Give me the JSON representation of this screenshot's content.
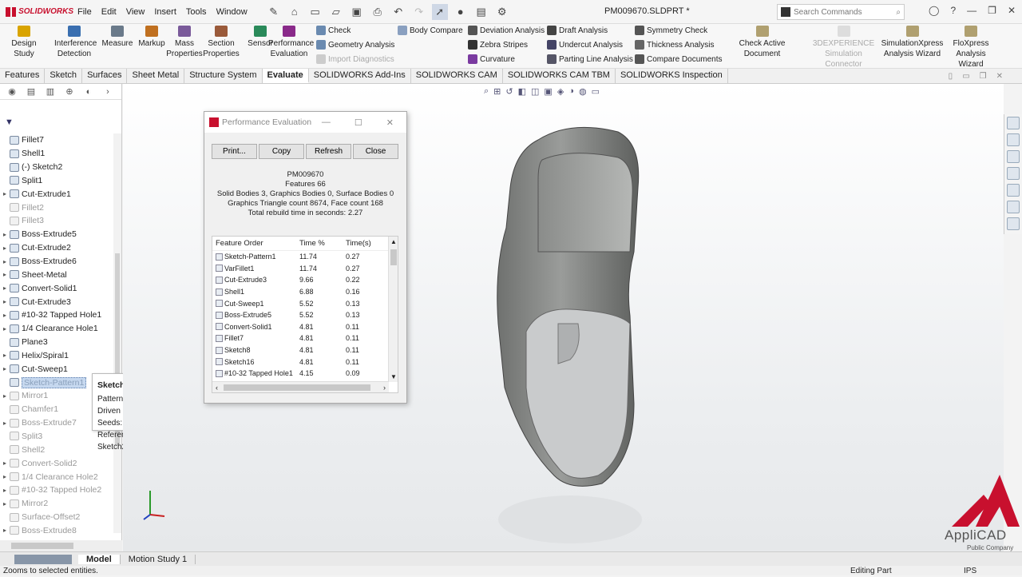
{
  "app": {
    "logo_text": "SOLIDWORKS",
    "menu": [
      "File",
      "Edit",
      "View",
      "Insert",
      "Tools",
      "Window"
    ],
    "doc_title": "PM009670.SLDPRT *",
    "search_placeholder": "Search Commands"
  },
  "ribbon": {
    "large": [
      {
        "label": "Design Study",
        "color": "#d9a400"
      },
      {
        "label": "Interference Detection",
        "color": "#3a6fb0"
      },
      {
        "label": "Measure",
        "color": "#6a7a8a"
      },
      {
        "label": "Markup",
        "color": "#c07020"
      },
      {
        "label": "Mass Properties",
        "color": "#7a5a9a"
      },
      {
        "label": "Section Properties",
        "color": "#9a5a3a"
      },
      {
        "label": "Sensor",
        "color": "#2a8a5a"
      },
      {
        "label": "Performance Evaluation",
        "color": "#8a2a8a"
      }
    ],
    "small_col1": [
      {
        "label": "Check",
        "grey": false
      },
      {
        "label": "Geometry Analysis",
        "grey": false
      },
      {
        "label": "Import Diagnostics",
        "grey": true
      }
    ],
    "body_compare": "Body Compare",
    "col2": [
      "Deviation Analysis",
      "Zebra Stripes",
      "Curvature"
    ],
    "col3": [
      "Draft Analysis",
      "Undercut Analysis",
      "Parting Line Analysis"
    ],
    "col4": [
      "Symmetry Check",
      "Thickness Analysis",
      "Compare Documents"
    ],
    "check_active": "Check Active Document",
    "experience": "3DEXPERIENCE Simulation Connector",
    "simxpress": "SimulationXpress Analysis Wizard",
    "floxpress": "FloXpress Analysis Wizard"
  },
  "tabs": [
    "Features",
    "Sketch",
    "Surfaces",
    "Sheet Metal",
    "Structure System",
    "Evaluate",
    "SOLIDWORKS Add-Ins",
    "SOLIDWORKS CAM",
    "SOLIDWORKS CAM TBM",
    "SOLIDWORKS Inspection"
  ],
  "active_tab": "Evaluate",
  "tree": [
    {
      "label": "Fillet7",
      "state": "normal",
      "arrow": false
    },
    {
      "label": "Shell1",
      "state": "normal",
      "arrow": false
    },
    {
      "label": "(-) Sketch2",
      "state": "normal",
      "arrow": false
    },
    {
      "label": "Split1",
      "state": "normal",
      "arrow": false
    },
    {
      "label": "Cut-Extrude1",
      "state": "normal",
      "arrow": true
    },
    {
      "label": "Fillet2",
      "state": "sup",
      "arrow": false
    },
    {
      "label": "Fillet3",
      "state": "sup",
      "arrow": false
    },
    {
      "label": "Boss-Extrude5",
      "state": "normal",
      "arrow": true
    },
    {
      "label": "Cut-Extrude2",
      "state": "normal",
      "arrow": true
    },
    {
      "label": "Boss-Extrude6",
      "state": "normal",
      "arrow": true
    },
    {
      "label": "Sheet-Metal",
      "state": "normal",
      "arrow": true
    },
    {
      "label": "Convert-Solid1",
      "state": "normal",
      "arrow": true
    },
    {
      "label": "Cut-Extrude3",
      "state": "normal",
      "arrow": true
    },
    {
      "label": "#10-32 Tapped Hole1",
      "state": "normal",
      "arrow": true
    },
    {
      "label": "1/4 Clearance Hole1",
      "state": "normal",
      "arrow": true
    },
    {
      "label": "Plane3",
      "state": "normal",
      "arrow": false
    },
    {
      "label": "Helix/Spiral1",
      "state": "normal",
      "arrow": true
    },
    {
      "label": "Cut-Sweep1",
      "state": "normal",
      "arrow": true
    },
    {
      "label": "Sketch-Pattern1",
      "state": "sel",
      "arrow": false
    },
    {
      "label": "Mirror1",
      "state": "sup",
      "arrow": true
    },
    {
      "label": "Chamfer1",
      "state": "sup",
      "arrow": false
    },
    {
      "label": "Boss-Extrude7",
      "state": "sup",
      "arrow": true
    },
    {
      "label": "Split3",
      "state": "sup",
      "arrow": false
    },
    {
      "label": "Shell2",
      "state": "sup",
      "arrow": false
    },
    {
      "label": "Convert-Solid2",
      "state": "sup",
      "arrow": true
    },
    {
      "label": "1/4 Clearance Hole2",
      "state": "sup",
      "arrow": true
    },
    {
      "label": "#10-32 Tapped Hole2",
      "state": "sup",
      "arrow": true
    },
    {
      "label": "Mirror2",
      "state": "sup",
      "arrow": true
    },
    {
      "label": "Surface-Offset2",
      "state": "sup",
      "arrow": false
    },
    {
      "label": "Boss-Extrude8",
      "state": "sup",
      "arrow": true
    }
  ],
  "tooltip": {
    "title": "Sketch-Pattern1",
    "lines": [
      "Pattern type: Sketch Driven",
      "Seeds: Cut-Sweep1",
      "Reference Sketch: Sketch20"
    ]
  },
  "dialog": {
    "title": "Performance Evaluation",
    "buttons": [
      "Print...",
      "Copy",
      "Refresh",
      "Close"
    ],
    "info": [
      "PM009670",
      "Features 66",
      "Solid Bodies 3, Graphics Bodies 0, Surface Bodies 0",
      "Graphics Triangle count 8674, Face count 168",
      "Total rebuild time in seconds: 2.27"
    ],
    "columns": [
      "Feature Order",
      "Time %",
      "Time(s)"
    ],
    "rows": [
      [
        "Sketch-Pattern1",
        "11.74",
        "0.27"
      ],
      [
        "VarFillet1",
        "11.74",
        "0.27"
      ],
      [
        "Cut-Extrude3",
        "9.66",
        "0.22"
      ],
      [
        "Shell1",
        "6.88",
        "0.16"
      ],
      [
        "Cut-Sweep1",
        "5.52",
        "0.13"
      ],
      [
        "Boss-Extrude5",
        "5.52",
        "0.13"
      ],
      [
        "Convert-Solid1",
        "4.81",
        "0.11"
      ],
      [
        "Fillet7",
        "4.81",
        "0.11"
      ],
      [
        "Sketch8",
        "4.81",
        "0.11"
      ],
      [
        "Sketch16",
        "4.81",
        "0.11"
      ],
      [
        "#10-32 Tapped Hole1",
        "4.15",
        "0.09"
      ]
    ]
  },
  "bottom_tabs": [
    "Model",
    "Motion Study 1"
  ],
  "status": {
    "left": "Zooms to selected entities.",
    "mode": "Editing Part",
    "units": "IPS"
  },
  "brand": {
    "name": "AppliCAD",
    "sub": "Public Company Limited"
  }
}
